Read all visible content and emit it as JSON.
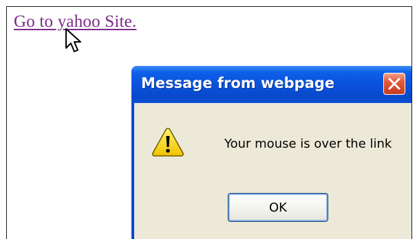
{
  "page": {
    "link_text": "Go to yahoo Site.",
    "link_color": "#7a2a8a"
  },
  "cursor": {
    "icon": "arrow-pointer-icon"
  },
  "dialog": {
    "title": "Message from webpage",
    "title_bar_color": "#0a50da",
    "close_icon": "close-icon",
    "close_button_color": "#e2583a",
    "icon": "warning-icon",
    "message": "Your mouse is over the link",
    "body_color": "#ece9d8",
    "ok_label": "OK"
  }
}
